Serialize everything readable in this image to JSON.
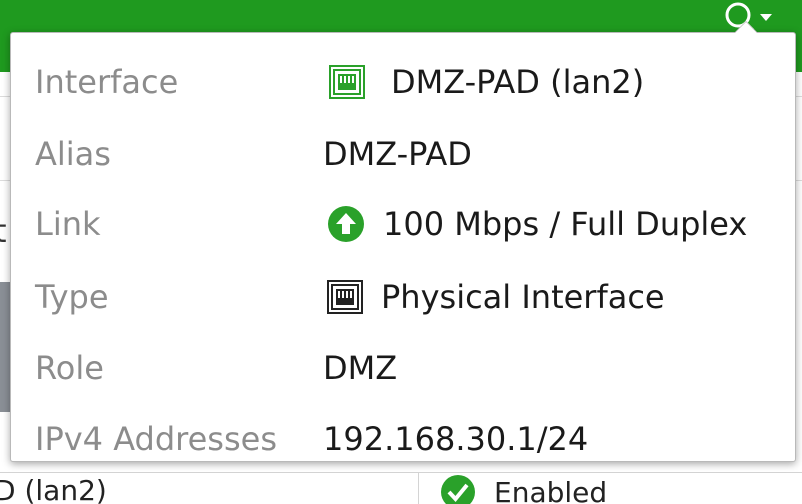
{
  "colors": {
    "brand_green": "#1f9a1f",
    "icon_green": "#2aa12a",
    "label_gray": "#8c8c8c",
    "value_text": "#1a1a1a"
  },
  "header": {
    "search_icon": "search-icon",
    "dropdown_icon": "caret-down-icon"
  },
  "background": {
    "row_partial_name": "D (lan2)",
    "row_partial_status": "Enabled",
    "status_icon": "check-circle-icon",
    "partial_char": "t"
  },
  "popover": {
    "rows": [
      {
        "label": "Interface",
        "value": "DMZ-PAD (lan2)",
        "icon": "ethernet-port-green-icon"
      },
      {
        "label": "Alias",
        "value": "DMZ-PAD"
      },
      {
        "label": "Link",
        "value": "100 Mbps / Full Duplex",
        "icon": "arrow-up-circle-icon"
      },
      {
        "label": "Type",
        "value": "Physical Interface",
        "icon": "ethernet-port-icon"
      },
      {
        "label": "Role",
        "value": "DMZ"
      },
      {
        "label": "IPv4 Addresses",
        "value": "192.168.30.1/24"
      }
    ]
  }
}
